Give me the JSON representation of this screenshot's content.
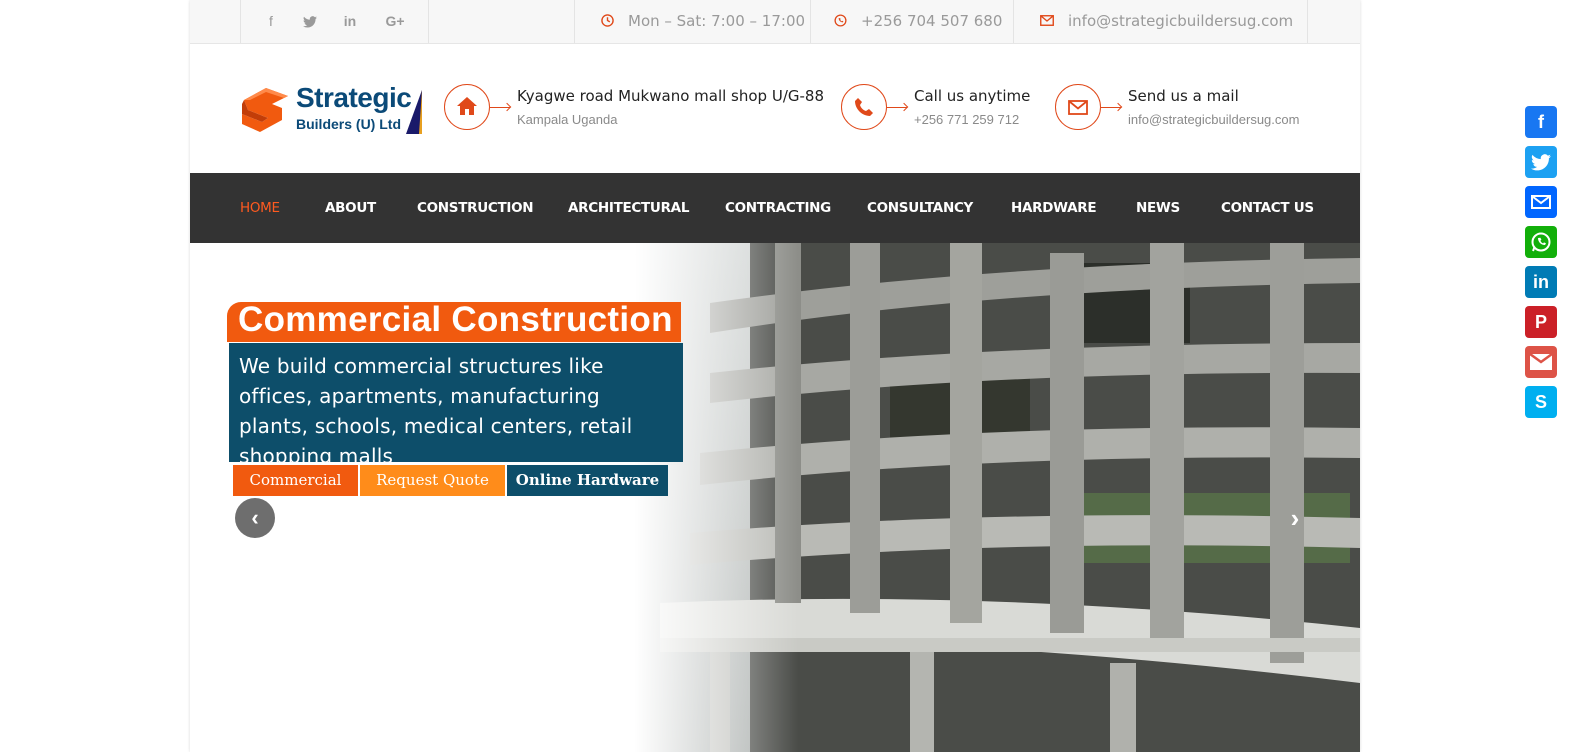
{
  "topbar": {
    "social": [
      {
        "name": "facebook",
        "glyph": "f"
      },
      {
        "name": "twitter",
        "glyph": "✐"
      },
      {
        "name": "linkedin",
        "glyph": "in"
      },
      {
        "name": "google-plus",
        "glyph": "G+"
      }
    ],
    "hours": "Mon – Sat: 7:00 – 17:00",
    "phone": "+256 704 507 680",
    "email": "info@strategicbuildersug.com"
  },
  "logo": {
    "line1": "Strategic",
    "line2": "Builders (U) Ltd"
  },
  "header": {
    "address_title": "Kyagwe road Mukwano mall shop U/G-88",
    "address_sub": "Kampala Uganda",
    "call_title": "Call us anytime",
    "call_sub": "+256 771 259 712",
    "mail_title": "Send us a mail",
    "mail_sub": "info@strategicbuildersug.com"
  },
  "nav": {
    "items": [
      "HOME",
      "ABOUT",
      "CONSTRUCTION",
      "ARCHITECTURAL",
      "CONTRACTING",
      "CONSULTANCY",
      "HARDWARE",
      "NEWS",
      "CONTACT US"
    ],
    "active": "HOME"
  },
  "hero": {
    "title": "Commercial Construction",
    "description": "We build commercial structures like offices, apartments, manufacturing plants, schools, medical centers, retail shopping malls",
    "buttons": [
      "Commercial",
      "Request Quote",
      "Online Hardware"
    ]
  },
  "share_bar": [
    "facebook",
    "twitter",
    "email",
    "whatsapp",
    "linkedin",
    "pinterest",
    "gmail",
    "skype"
  ],
  "colors": {
    "accent": "#e0491a",
    "nav_bg": "#333333",
    "hero_desc_bg": "#0d4e6a",
    "button_commercial": "#f15a0f",
    "button_quote": "#ff8c1a",
    "button_hardware": "#0d4e6a"
  }
}
